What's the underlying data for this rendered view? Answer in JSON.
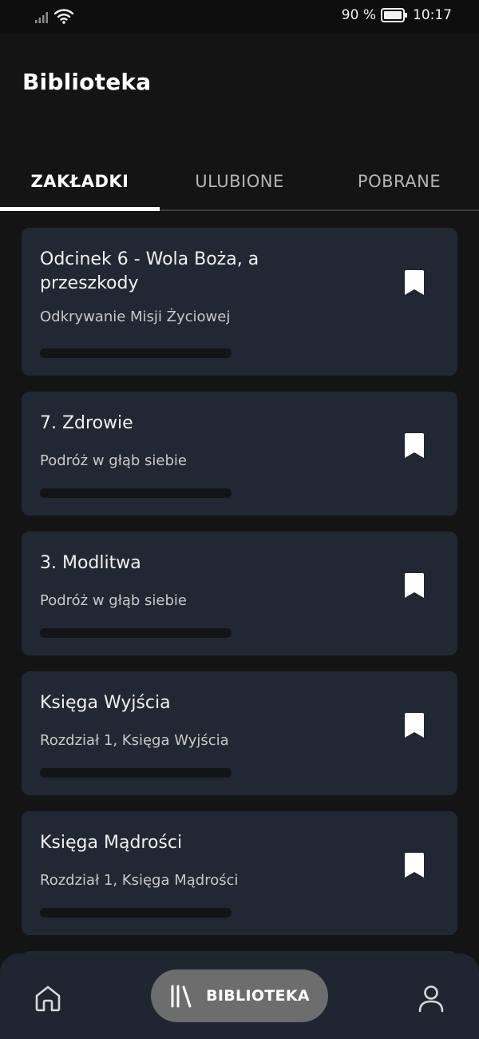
{
  "status_bar": {
    "battery": "90 %",
    "time": "10:17"
  },
  "header": {
    "title": "Biblioteka"
  },
  "tabs": [
    {
      "label": "ZAKŁADKI",
      "active": true
    },
    {
      "label": "ULUBIONE",
      "active": false
    },
    {
      "label": "POBRANE",
      "active": false
    }
  ],
  "items": [
    {
      "title": "Odcinek 6 - Wola Boża, a przeszkody",
      "subtitle": "Odkrywanie Misji Życiowej",
      "progress": 0,
      "icon": "bookmark-icon"
    },
    {
      "title": "7. Zdrowie",
      "subtitle": "Podróż w głąb siebie",
      "progress": 0,
      "icon": "bookmark-icon"
    },
    {
      "title": "3. Modlitwa",
      "subtitle": "Podróż w głąb siebie",
      "progress": 0,
      "icon": "bookmark-icon"
    },
    {
      "title": "Księga Wyjścia",
      "subtitle": "Rozdział 1, Księga Wyjścia",
      "progress": 0,
      "icon": "bookmark-icon"
    },
    {
      "title": "Księga Mądrości",
      "subtitle": "Rozdział 1, Księga Mądrości",
      "progress": 0,
      "icon": "bookmark-icon"
    }
  ],
  "bottom_nav": {
    "home_icon": "home-icon",
    "library_label": "BIBLIOTEKA",
    "library_icon": "library-icon",
    "profile_icon": "profile-icon"
  },
  "colors": {
    "background": "#141414",
    "card": "#222833",
    "nav": "#202631",
    "active_pill": "#6d6d6d"
  }
}
